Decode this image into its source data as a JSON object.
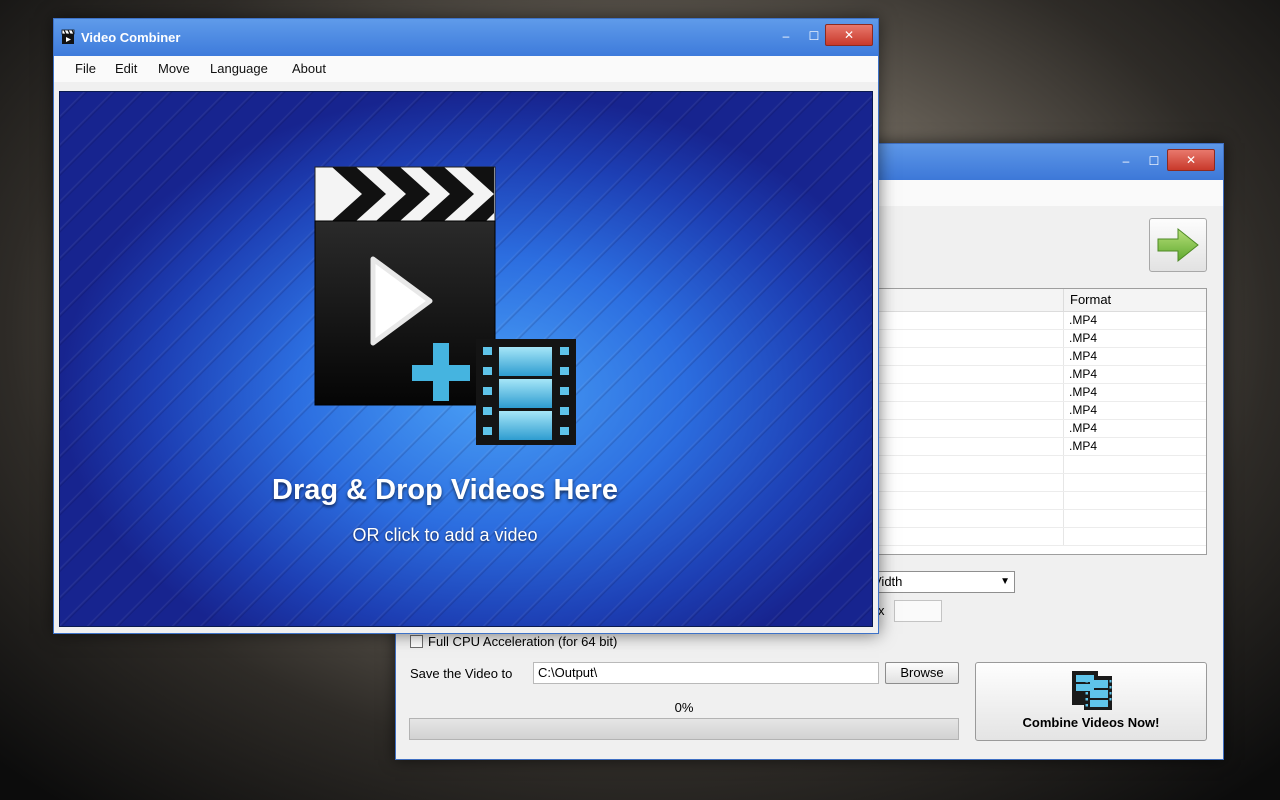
{
  "back_window": {
    "controls": {
      "minimize": "–",
      "maximize": "☐",
      "close": "✕"
    },
    "file_list": {
      "format_header": "Format",
      "rows": [
        ".MP4",
        ".MP4",
        ".MP4",
        ".MP4",
        ".MP4",
        ".MP4",
        ".MP4",
        ".MP4",
        "",
        "",
        "",
        "",
        ""
      ]
    },
    "resize_select": {
      "value": "Vidth"
    },
    "size_x_label": "x",
    "cpu_acceleration": {
      "label": "Full CPU Acceleration (for 64 bit)",
      "checked": false
    },
    "save_label": "Save the Video to",
    "save_path": "C:\\Output\\",
    "browse_label": "Browse",
    "combine_label": "Combine Videos Now!",
    "progress": {
      "text": "0%",
      "value": 0
    }
  },
  "front_window": {
    "title": "Video Combiner",
    "controls": {
      "minimize": "–",
      "maximize": "☐",
      "close": "✕"
    },
    "menu": [
      "File",
      "Edit",
      "Move",
      "Language",
      "About"
    ],
    "drop_zone": {
      "title": "Drag & Drop Videos Here",
      "subtitle": "OR click to add a video"
    }
  },
  "colors": {
    "titlebar": "#3e7bdb",
    "close_button": "#c8392b",
    "drop_zone_blue": "#2c6ee0",
    "plus_cyan": "#45b4e0",
    "arrow_green": "#7cc142"
  }
}
